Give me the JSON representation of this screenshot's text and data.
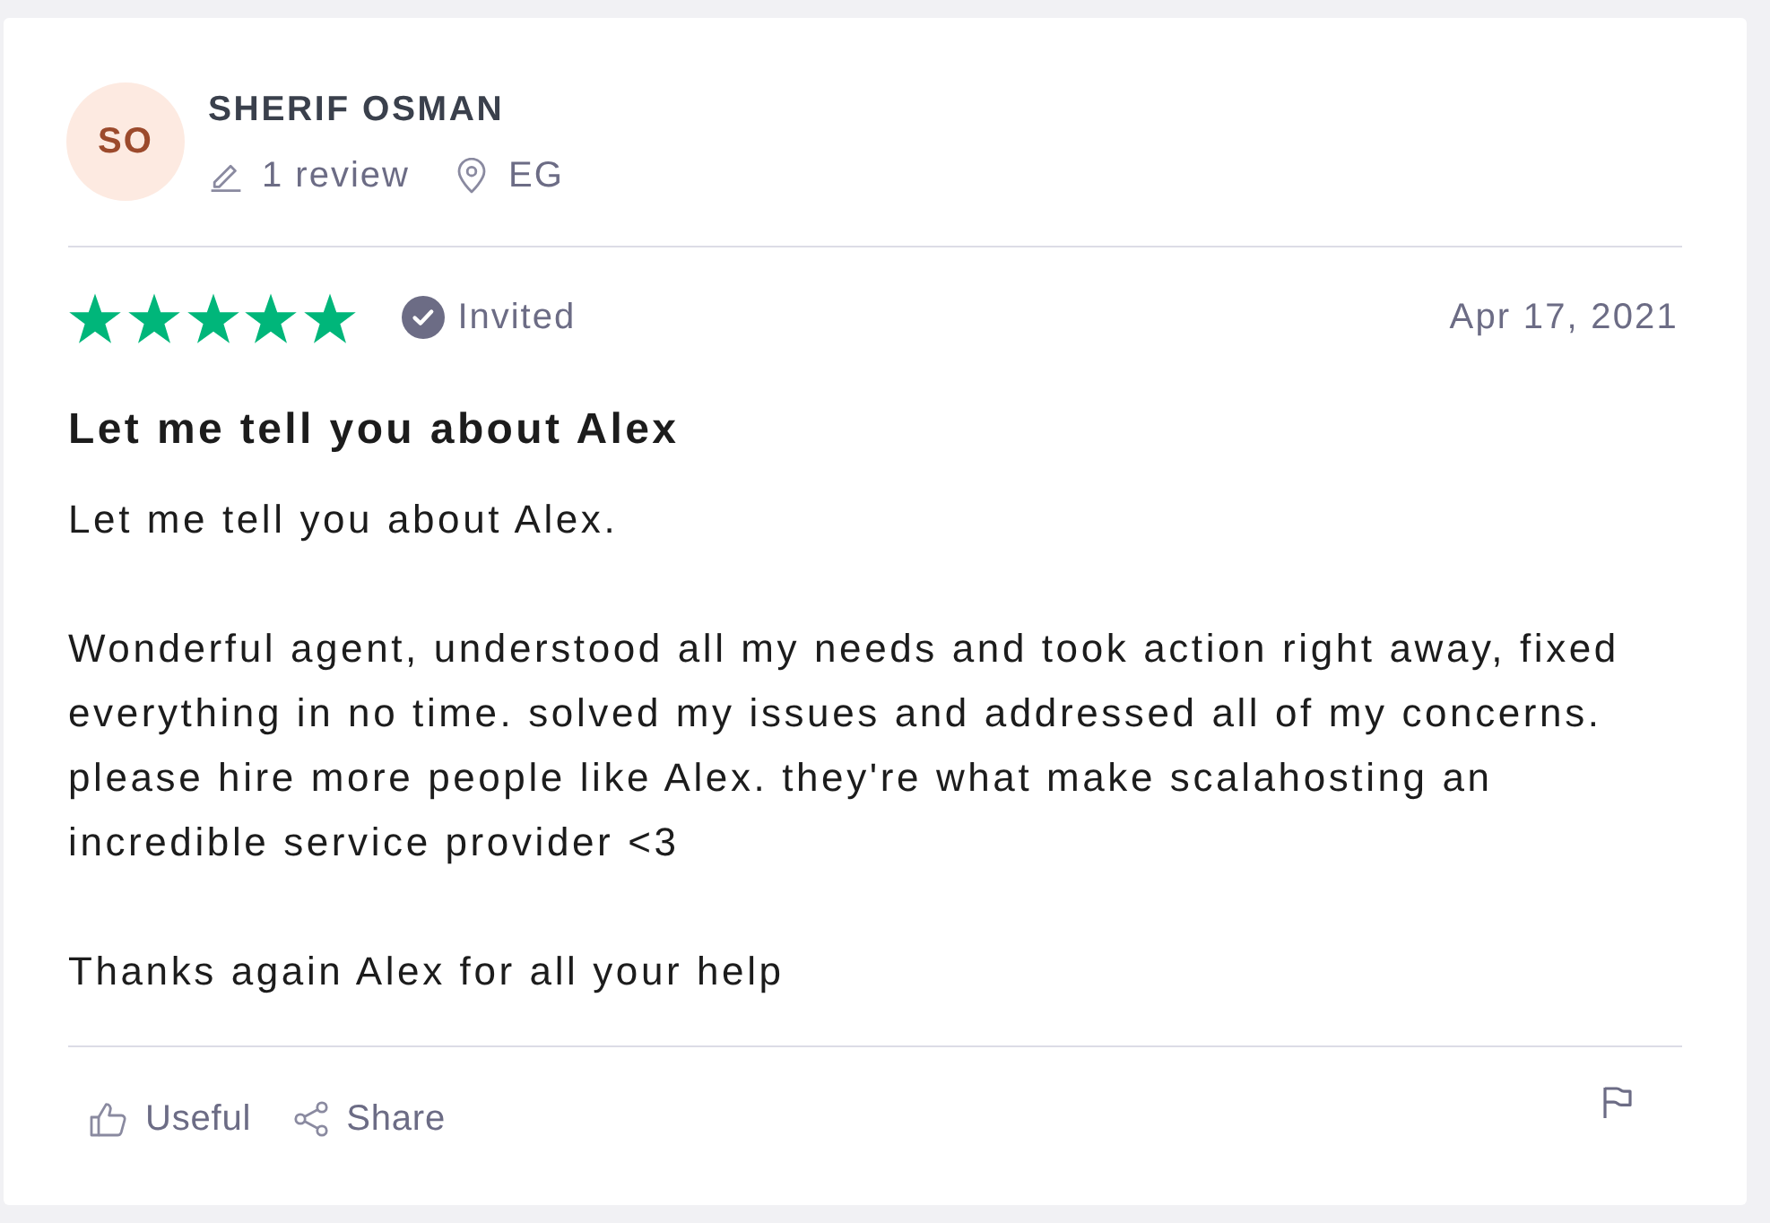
{
  "reviewer": {
    "initials": "SO",
    "name": "SHERIF OSMAN",
    "review_count": "1 review",
    "country": "EG"
  },
  "review": {
    "stars": 5,
    "invited": "Invited",
    "date": "Apr 17, 2021",
    "title": "Let me tell you about Alex",
    "paragraphs": [
      "Let me tell you about Alex.",
      "Wonderful agent, understood all my needs and took action right away, fixed everything in no time. solved my issues and addressed all of my concerns. please hire more people like Alex. they're what make scalahosting an incredible service provider <3",
      "Thanks again Alex for all your help"
    ]
  },
  "actions": [
    {
      "kind": "useful",
      "label": "Useful"
    },
    {
      "kind": "share",
      "label": "Share"
    }
  ]
}
